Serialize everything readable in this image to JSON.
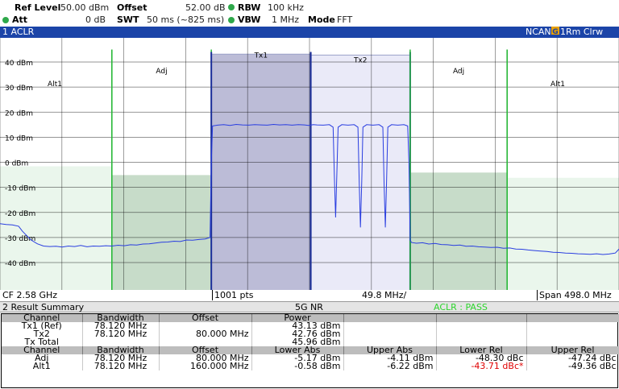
{
  "header": {
    "ref_level_label": "Ref Level",
    "ref_level_value": "50.00 dBm",
    "offset_label": "Offset",
    "offset_value": "52.00 dB",
    "rbw_label": "RBW",
    "rbw_value": "100 kHz",
    "att_label": "Att",
    "att_value": "0 dB",
    "swt_label": "SWT",
    "swt_value": "50 ms (~825 ms)",
    "vbw_label": "VBW",
    "vbw_value": "1 MHz",
    "mode_label": "Mode",
    "mode_value": "FFT",
    "indicator_color": "#2ea84a"
  },
  "window": {
    "title": "1 ACLR",
    "ncan": "NCAN",
    "trace_mark": "G",
    "trace_mode": "1Rm Clrw",
    "bar_color": "#1b44a8"
  },
  "chart_data": {
    "type": "line",
    "title": "",
    "ylabel": "",
    "xlabel": "",
    "x_range": [
      0,
      498.0
    ],
    "ylim": [
      -45,
      45
    ],
    "y_ticks": [
      "40 dBm",
      "30 dBm",
      "20 dBm",
      "10 dBm",
      "0 dBm",
      "-10 dBm",
      "-20 dBm",
      "-30 dBm",
      "-40 dBm"
    ],
    "y_tick_values": [
      40,
      30,
      20,
      10,
      0,
      -10,
      -20,
      -30,
      -40
    ],
    "grid": true,
    "channels": [
      {
        "label": "Alt1",
        "x0": 0,
        "x1": 90,
        "level": -1.6,
        "fill": "#eaf6ec",
        "type": "alt",
        "label_side": "left"
      },
      {
        "label": "Adj",
        "x0": 90,
        "x1": 170,
        "level": -5.1,
        "fill": "#c7dcc9",
        "type": "adj"
      },
      {
        "label": "Tx1",
        "x0": 170,
        "x1": 250,
        "level": 43.13,
        "fill": "#bcbcd7",
        "type": "tx"
      },
      {
        "label": "Tx2",
        "x0": 250,
        "x1": 330,
        "level": 42.76,
        "fill": "#eaeaf8",
        "type": "tx"
      },
      {
        "label": "Adj",
        "x0": 330,
        "x1": 408,
        "level": -4.1,
        "fill": "#c7dcc9",
        "type": "adj"
      },
      {
        "label": "Alt1",
        "x0": 408,
        "x1": 498,
        "level": -6.2,
        "fill": "#eaf6ec",
        "type": "alt",
        "label_side": "right"
      }
    ],
    "trace_color": "#2a3ee0",
    "series": [
      {
        "x": [
          0,
          5,
          10,
          15,
          18,
          22,
          25,
          30,
          35,
          40,
          45,
          50,
          55,
          60,
          65,
          70,
          75,
          80,
          85,
          90,
          95,
          100,
          105,
          110,
          115,
          120,
          125,
          130,
          135,
          140,
          145,
          150,
          155,
          160,
          165,
          169,
          170,
          171,
          175,
          180,
          185,
          190,
          195,
          200,
          205,
          210,
          215,
          220,
          225,
          230,
          235,
          240,
          245,
          248,
          250,
          252,
          255,
          260,
          265,
          268,
          269,
          270,
          271,
          272,
          275,
          280,
          285,
          288,
          289,
          290,
          291,
          292,
          295,
          300,
          305,
          308,
          309,
          310,
          311,
          312,
          315,
          320,
          325,
          328,
          329,
          330,
          331,
          335,
          340,
          345,
          350,
          355,
          360,
          365,
          370,
          375,
          380,
          385,
          390,
          395,
          400,
          405,
          410,
          415,
          420,
          425,
          430,
          435,
          440,
          445,
          450,
          455,
          460,
          465,
          470,
          475,
          480,
          485,
          490,
          495,
          498
        ],
        "y": [
          -24.5,
          -24.8,
          -25.0,
          -25.5,
          -27.5,
          -29.5,
          -31.0,
          -32.5,
          -33.4,
          -33.6,
          -33.5,
          -33.8,
          -33.4,
          -33.6,
          -33.2,
          -33.7,
          -33.4,
          -33.5,
          -33.3,
          -33.4,
          -33.1,
          -33.3,
          -32.9,
          -33.0,
          -32.6,
          -32.5,
          -32.2,
          -31.9,
          -31.8,
          -31.5,
          -31.6,
          -31.0,
          -31.1,
          -30.8,
          -30.6,
          -30.0,
          0,
          14.5,
          14.8,
          15.0,
          14.7,
          15.1,
          14.9,
          14.8,
          15.0,
          14.9,
          14.8,
          15.1,
          14.9,
          15.0,
          14.8,
          15.0,
          14.9,
          14.7,
          14.8,
          15.0,
          14.9,
          14.8,
          15.0,
          14.0,
          -5.0,
          -22.0,
          -5.0,
          14.0,
          15.0,
          14.8,
          15.0,
          14.0,
          -8.0,
          -26.0,
          -8.0,
          14.0,
          15.0,
          14.8,
          15.0,
          14.0,
          -8.0,
          -26.0,
          -8.0,
          14.0,
          15.0,
          14.8,
          15.0,
          14.5,
          0,
          -31.0,
          -32.0,
          -32.3,
          -32.1,
          -32.6,
          -32.4,
          -32.8,
          -32.9,
          -33.2,
          -33.0,
          -33.5,
          -33.4,
          -33.7,
          -33.8,
          -34.0,
          -33.9,
          -34.3,
          -34.2,
          -34.6,
          -34.7,
          -35.0,
          -35.2,
          -35.4,
          -35.6,
          -35.9,
          -36.0,
          -36.2,
          -36.3,
          -36.5,
          -36.6,
          -36.7,
          -36.5,
          -36.8,
          -36.6,
          -36.2,
          -34.6
        ]
      }
    ]
  },
  "plot_footer": {
    "cf": "CF 2.58 GHz",
    "pts": "1001 pts",
    "div": "49.8 MHz/",
    "span": "Span 498.0 MHz"
  },
  "result": {
    "title": "2 Result Summary",
    "standard": "5G NR",
    "aclr_status": "ACLR : PASS",
    "status_color": "#2ed52e",
    "tx_headers": [
      "Channel",
      "Bandwidth",
      "Offset",
      "Power",
      "",
      "",
      ""
    ],
    "tx_rows": [
      [
        "Tx1 (Ref)",
        "78.120 MHz",
        "",
        "43.13 dBm",
        "",
        "",
        ""
      ],
      [
        "Tx2",
        "78.120 MHz",
        "80.000 MHz",
        "42.76 dBm",
        "",
        "",
        ""
      ],
      [
        "Tx Total",
        "",
        "",
        "45.96 dBm",
        "",
        "",
        ""
      ]
    ],
    "adj_headers": [
      "Channel",
      "Bandwidth",
      "Offset",
      "Lower Abs",
      "Upper Abs",
      "Lower Rel",
      "Upper Rel"
    ],
    "adj_rows": [
      [
        "Adj",
        "78.120 MHz",
        "80.000 MHz",
        "-5.17 dBm",
        "-4.11 dBm",
        "-48.30 dBc",
        "-47.24 dBc"
      ],
      [
        "Alt1",
        "78.120 MHz",
        "160.000 MHz",
        "-0.58 dBm",
        "-6.22 dBm",
        "-43.71 dBc*",
        "-49.36 dBc"
      ]
    ]
  }
}
